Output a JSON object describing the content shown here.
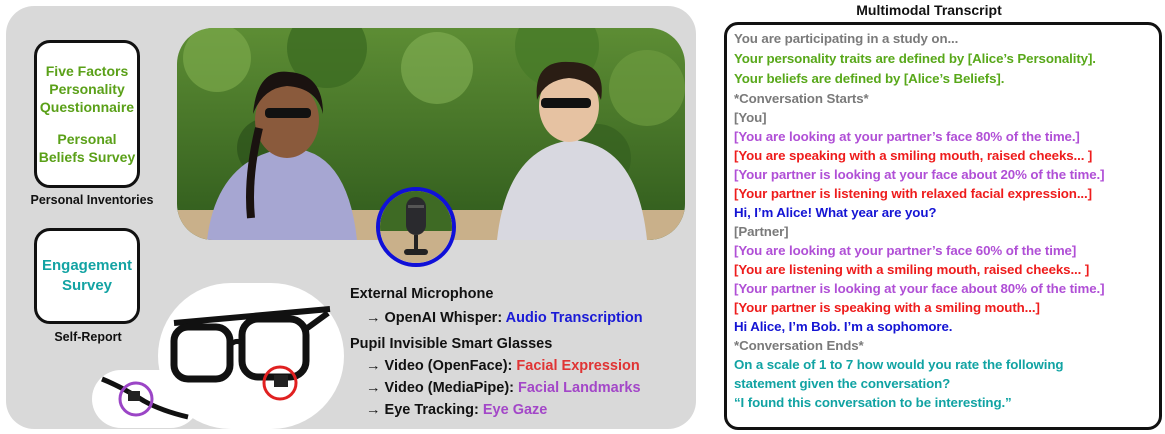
{
  "inventories": {
    "five_factors": [
      "Five Factors",
      "Personality",
      "Questionnaire"
    ],
    "beliefs": [
      "Personal",
      "Beliefs Survey"
    ],
    "caption": "Personal Inventories"
  },
  "self_report": {
    "engagement": [
      "Engagement",
      "Survey"
    ],
    "caption": "Self-Report"
  },
  "legend": {
    "mic_title": "External Microphone",
    "mic_prefix": "→ OpenAI Whisper: ",
    "mic_value": "Audio Transcription",
    "glasses_title": "Pupil Invisible Smart Glasses",
    "items": [
      {
        "prefix": "→ Video (OpenFace): ",
        "value": "Facial Expression"
      },
      {
        "prefix": "→ Video (MediaPipe): ",
        "value": "Facial Landmarks"
      },
      {
        "prefix": "→ Eye Tracking: ",
        "value": "Eye Gaze"
      }
    ]
  },
  "transcript": {
    "title": "Multimodal Transcript",
    "lines": [
      {
        "text": "You are participating in a study on...",
        "color": "gray"
      },
      {
        "text": "Your personality traits are defined by [Alice’s Personality].",
        "color": "green"
      },
      {
        "text": "Your beliefs are defined by [Alice’s Beliefs].",
        "color": "green"
      },
      {
        "text": "*Conversation Starts*",
        "color": "gray"
      },
      {
        "text": "[You]",
        "color": "gray"
      },
      {
        "text": "[You are looking at your partner’s face 80% of the time.]",
        "color": "purple"
      },
      {
        "text": "[You are speaking with a smiling mouth, raised cheeks... ]",
        "color": "red"
      },
      {
        "text": "[Your partner is looking at your face about 20% of the time.]",
        "color": "purple"
      },
      {
        "text": "[Your partner is listening with relaxed facial expression...]",
        "color": "red"
      },
      {
        "text": "Hi, I’m Alice! What year are you?",
        "color": "blue"
      },
      {
        "text": "[Partner]",
        "color": "gray"
      },
      {
        "text": "[You are looking at your partner’s face 60% of the time]",
        "color": "purple"
      },
      {
        "text": "[You are listening with a smiling mouth, raised cheeks... ]",
        "color": "red"
      },
      {
        "text": "[Your partner is looking at your face about 80% of the time.]",
        "color": "purple"
      },
      {
        "text": "[Your partner is speaking with a smiling mouth...]",
        "color": "red"
      },
      {
        "text": "Hi Alice, I’m Bob. I’m a sophomore.",
        "color": "blue"
      },
      {
        "text": "*Conversation Ends*",
        "color": "gray"
      },
      {
        "text": "On a scale of 1 to 7 how would you rate the following",
        "color": "teal"
      },
      {
        "text": "statement given the conversation?",
        "color": "teal"
      },
      {
        "text": "“I found this conversation to be interesting.”",
        "color": "teal"
      }
    ]
  },
  "colors": {
    "green": "#58a81a",
    "teal": "#11a3a3",
    "blue": "#1414d4",
    "red": "#ee1c1c",
    "purple": "#b04fd6",
    "gray": "#7a7a7a",
    "panel": "#d9d9d9"
  }
}
